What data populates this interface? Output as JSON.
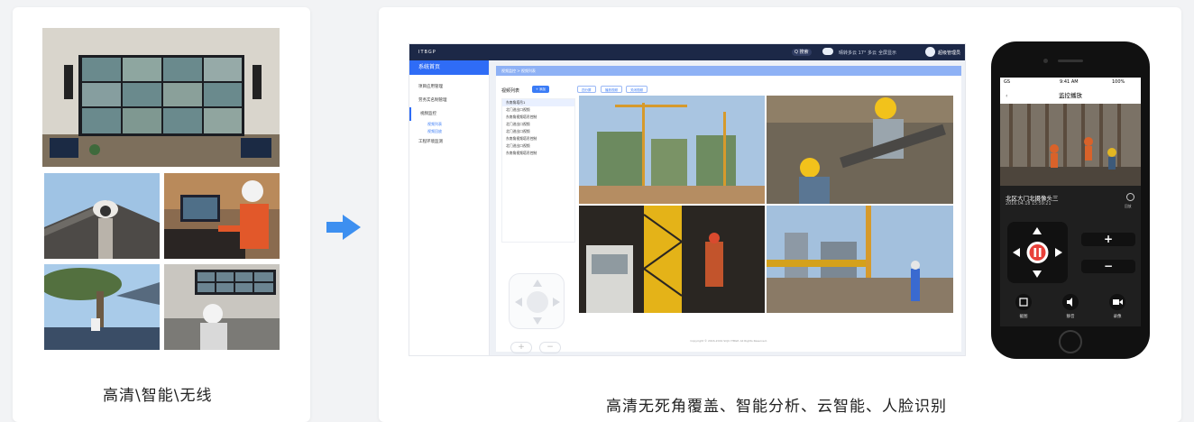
{
  "left": {
    "caption": "高清\\智能\\无线"
  },
  "right": {
    "caption": "高清无死角覆盖、智能分析、云智能、人脸识别"
  },
  "desktop": {
    "logo": "ITBGP",
    "search_label": "Q 搜索",
    "weather_text": "晴转多云 17° 多云",
    "fullscreen_label": "全屏显示",
    "user_name": "超级管理员",
    "sidebar": {
      "home": "系统首页",
      "items": [
        "项目应用管理",
        "劳务实名制管理",
        "视频监控",
        "工程环境监测"
      ],
      "sub_items": [
        "视频列表",
        "视频回放"
      ]
    },
    "breadcrumb": "视频监控 > 视频列表",
    "list_title": "视频列表",
    "add_button": "+ 添加",
    "chips": [
      "四分屏",
      "播放视频",
      "关闭视频"
    ],
    "cameras": [
      "东南角塔吊1",
      "北门进出口视频",
      "东南角视频塔吊控制",
      "北门进出口视频",
      "北门进出口视频",
      "东南角视频塔吊控制",
      "北门进出口视频",
      "东南角视频塔吊控制"
    ],
    "footer": "Copyright © 2016-2019 SCJU ITBGP. All Rights Reserved."
  },
  "phone": {
    "carrier": "GS",
    "time": "9:41 AM",
    "battery": "100%",
    "title": "监控播放",
    "camera_name": "北区大门北摄像头三",
    "timestamp": "2016.04.18 15:59:21",
    "replay_label": "回放",
    "plus": "+",
    "minus": "−",
    "tools": [
      "截图",
      "静音",
      "录像"
    ]
  }
}
